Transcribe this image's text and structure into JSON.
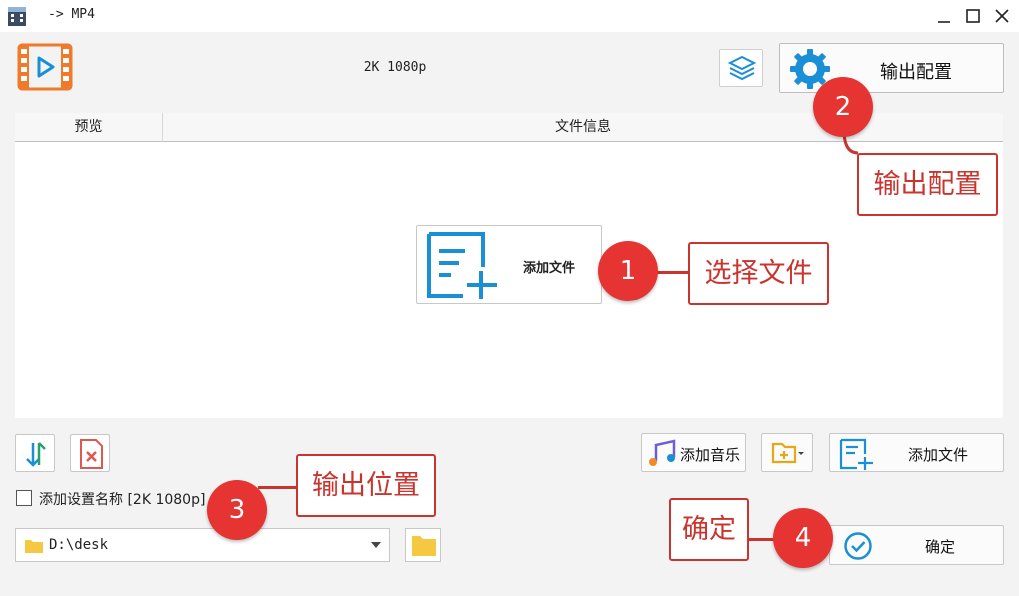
{
  "window": {
    "title": "-> MP4"
  },
  "toolbar": {
    "preset_label": "2K 1080p",
    "output_config_label": "输出配置"
  },
  "file_list": {
    "columns": [
      "预览",
      "文件信息"
    ],
    "add_file_label": "添加文件"
  },
  "bottom_bar": {
    "add_music_label": "添加音乐",
    "add_file_label": "添加文件",
    "confirm_label": "确定"
  },
  "options": {
    "add_setting_name_label": "添加设置名称 [2K 1080p]",
    "output_path": "D:\\desk"
  },
  "annotations": [
    {
      "number": "1",
      "text": "选择文件"
    },
    {
      "number": "2",
      "text": "输出配置"
    },
    {
      "number": "3",
      "text": "输出位置"
    },
    {
      "number": "4",
      "text": "确定"
    }
  ],
  "colors": {
    "accent_blue": "#1b8fd6",
    "logo_orange": "#ef7a2b",
    "annotation_red": "#e53431"
  }
}
